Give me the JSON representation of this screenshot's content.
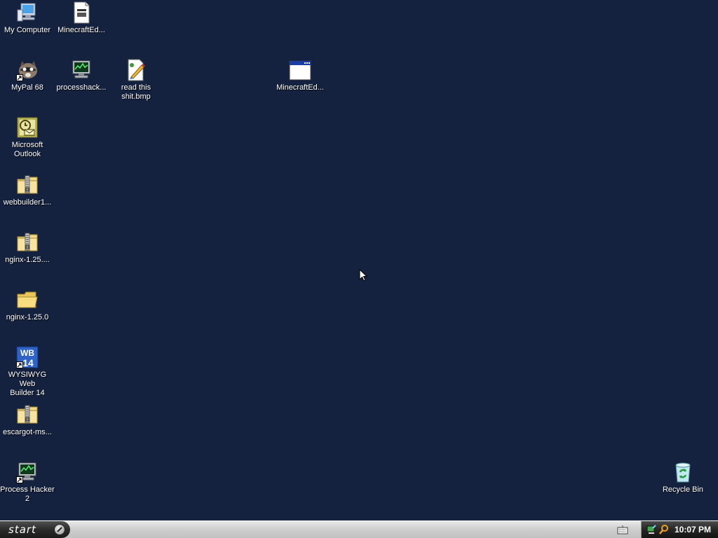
{
  "desktop": {
    "icons": [
      {
        "label": "My Computer"
      },
      {
        "label": "MinecraftEd..."
      },
      {
        "label": "MyPal 68"
      },
      {
        "label": "processhack..."
      },
      {
        "label": "read this\nshit.bmp"
      },
      {
        "label": "MinecraftEd..."
      },
      {
        "label": "Microsoft\nOutlook"
      },
      {
        "label": "webbuilder1..."
      },
      {
        "label": "nginx-1.25...."
      },
      {
        "label": "nginx-1.25.0"
      },
      {
        "label": "WYSIWYG Web\nBuilder 14"
      },
      {
        "label": "escargot-ms..."
      },
      {
        "label": "Process Hacker\n2"
      },
      {
        "label": "Recycle Bin"
      }
    ],
    "wb14_badge": "WB\n14"
  },
  "taskbar": {
    "start_label": "start",
    "clock": "10:07 PM"
  },
  "colors": {
    "desktop_background": "#15223f",
    "taskbar": "#cfcfcf",
    "tray": "#262626"
  }
}
